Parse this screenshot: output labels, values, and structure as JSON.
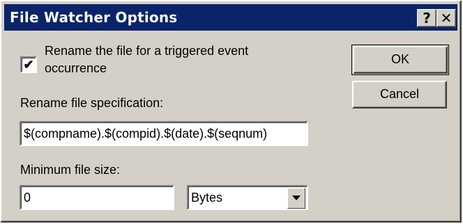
{
  "window": {
    "title": "File Watcher Options",
    "help_glyph": "?",
    "close_glyph": "✕"
  },
  "rename_checkbox": {
    "checked": true,
    "mark": "✔",
    "label_line1": "Rename the file for a triggered event",
    "label_line2": "occurrence"
  },
  "rename_spec": {
    "label": "Rename file specification:",
    "value": "$(compname).$(compid).$(date).$(seqnum)"
  },
  "min_size": {
    "label": "Minimum file size:",
    "value": "0",
    "unit": "Bytes"
  },
  "buttons": {
    "ok": "OK",
    "cancel": "Cancel"
  },
  "icons": {
    "help": "help-icon",
    "close": "close-icon",
    "dropdown": "chevron-down-icon"
  }
}
